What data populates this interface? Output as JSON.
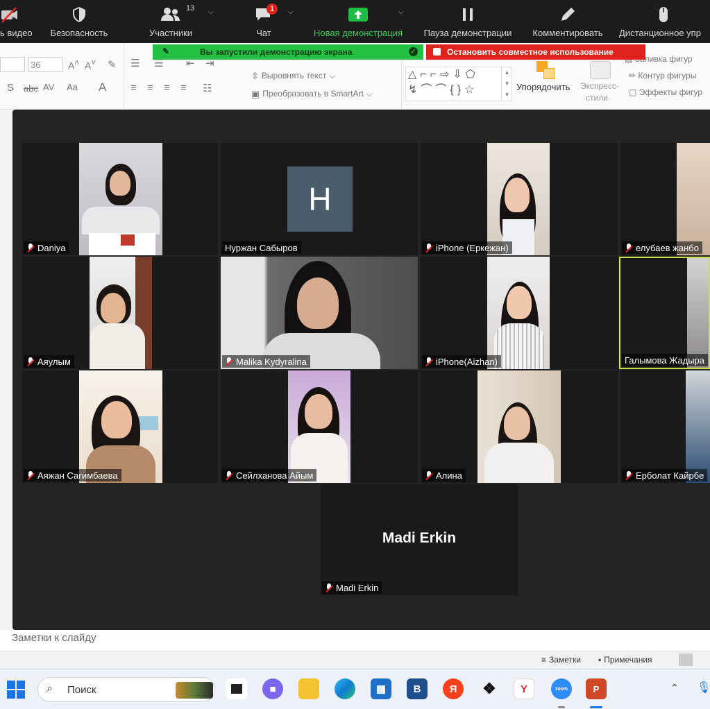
{
  "zoom_toolbar": {
    "items": [
      {
        "label": "ь видео",
        "icon": "video-off-icon"
      },
      {
        "label": "Безопасность",
        "icon": "shield-icon"
      },
      {
        "label": "Участники",
        "icon": "participants-icon",
        "count": "13"
      },
      {
        "label": "Чат",
        "icon": "chat-icon",
        "badge": "1"
      },
      {
        "label": "Новая демонстрация",
        "icon": "share-screen-icon"
      },
      {
        "label": "Пауза демонстрации",
        "icon": "pause-icon"
      },
      {
        "label": "Комментировать",
        "icon": "pencil-icon"
      },
      {
        "label": "Дистанционное упр",
        "icon": "mouse-icon"
      }
    ]
  },
  "share_banner": {
    "text": "Вы запустили демонстрацию экрана",
    "color": "#23c043"
  },
  "stop_banner": {
    "text": "Остановить совместное использование",
    "color": "#e0221c"
  },
  "ribbon": {
    "font_size": "36",
    "align_text": "Выровнять текст",
    "convert_smartart": "Преобразовать в SmartArt",
    "arrange": "Упорядочить",
    "express_styles_line1": "Экспресс-",
    "express_styles_line2": "стили",
    "shape_fill": "Заливка фигур",
    "shape_outline": "Контур фигуры",
    "shape_effects": "Эффекты фигур"
  },
  "participants": [
    {
      "name": "Daniya",
      "muted": true
    },
    {
      "name": "Нуржан Сабыров",
      "muted": false,
      "avatar_letter": "H"
    },
    {
      "name": "iPhone (Еркежан)",
      "muted": true
    },
    {
      "name": "елубаев жанбо",
      "muted": true
    },
    {
      "name": "Аяулым",
      "muted": true
    },
    {
      "name": "Malika Kydyralina",
      "muted": true
    },
    {
      "name": "iPhone(Aizhan)",
      "muted": true
    },
    {
      "name": "Галымова Жадыра",
      "muted": false,
      "active_speaker": true
    },
    {
      "name": "Аяжан Сагимбаева",
      "muted": true
    },
    {
      "name": "Сейлханова Айым",
      "muted": true
    },
    {
      "name": "Алина",
      "muted": true
    },
    {
      "name": "Ерболат Кайрбе",
      "muted": true
    },
    {
      "name": "Madi Erkin",
      "muted": true,
      "video_off": true
    }
  ],
  "notes_placeholder": "Заметки к слайду",
  "status_bar": {
    "notes": "Заметки",
    "comments": "Примечания"
  },
  "taskbar": {
    "search_placeholder": "Поиск"
  }
}
